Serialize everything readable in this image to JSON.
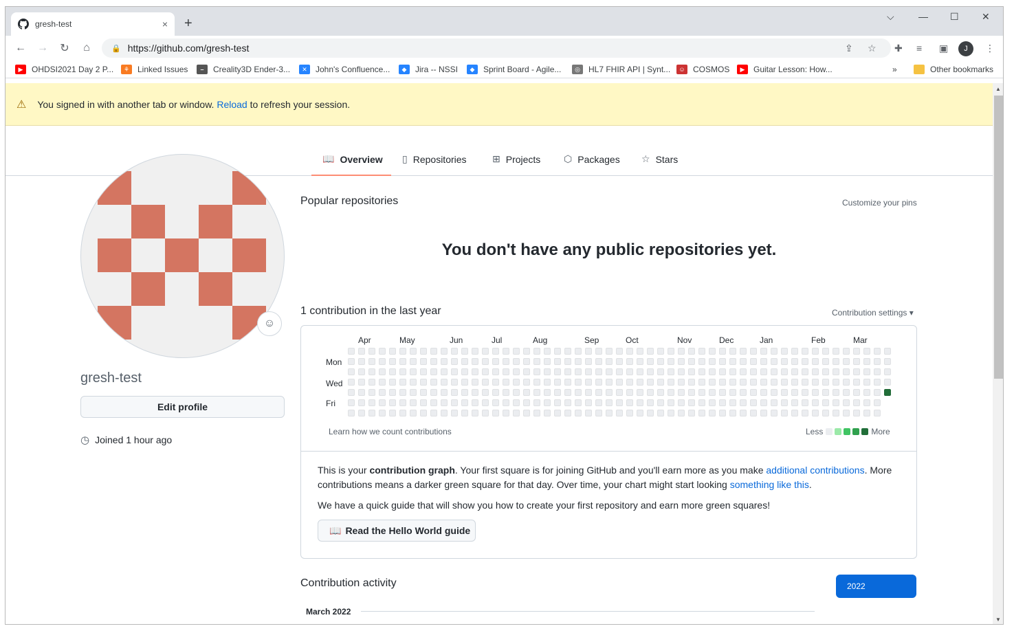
{
  "browser": {
    "tab_title": "gresh-test",
    "tab_close": "×",
    "new_tab": "+",
    "url": "https://github.com/gresh-test",
    "profile_initial": "J",
    "window_controls": [
      "⌵",
      "—",
      "☐",
      "✕"
    ]
  },
  "bookmarks": {
    "items": [
      {
        "label": "OHDSI2021 Day 2 P...",
        "icon": "youtube-icon",
        "color": "#ff0000"
      },
      {
        "label": "Linked Issues",
        "icon": "linked-issues-icon",
        "color": "#f97b22"
      },
      {
        "label": "Creality3D Ender-3...",
        "icon": "creality-icon",
        "color": "#555555"
      },
      {
        "label": "John's Confluence...",
        "icon": "confluence-icon",
        "color": "#2684ff"
      },
      {
        "label": "Jira -- NSSI",
        "icon": "jira-icon",
        "color": "#2684ff"
      },
      {
        "label": "Sprint Board - Agile...",
        "icon": "jira-icon",
        "color": "#2684ff"
      },
      {
        "label": "HL7 FHIR API | Synt...",
        "icon": "fhir-icon",
        "color": "#777777"
      },
      {
        "label": "COSMOS",
        "icon": "cosmos-icon",
        "color": "#cc3333"
      },
      {
        "label": "Guitar Lesson: How...",
        "icon": "youtube-icon",
        "color": "#ff0000"
      }
    ],
    "overflow": "»",
    "other": "Other bookmarks"
  },
  "flash": {
    "text_before": "You signed in with another tab or window.",
    "link": "Reload",
    "text_after": "to refresh your session."
  },
  "profile_tabs": [
    {
      "label": "Overview",
      "icon": "book-icon",
      "selected": true
    },
    {
      "label": "Repositories",
      "icon": "repo-icon",
      "selected": false
    },
    {
      "label": "Projects",
      "icon": "table-icon",
      "selected": false
    },
    {
      "label": "Packages",
      "icon": "package-icon",
      "selected": false
    },
    {
      "label": "Stars",
      "icon": "star-icon",
      "selected": false
    }
  ],
  "profile": {
    "username": "gresh-test",
    "edit_button": "Edit profile",
    "joined": "Joined 1 hour ago",
    "avatar_color": "#d47561"
  },
  "popular": {
    "heading": "Popular repositories",
    "customize": "Customize your pins",
    "empty": "You don't have any public repositories yet."
  },
  "contributions": {
    "heading": "1 contribution in the last year",
    "settings": "Contribution settings ▾",
    "months": [
      "Apr",
      "May",
      "Jun",
      "Jul",
      "Aug",
      "Sep",
      "Oct",
      "Nov",
      "Dec",
      "Jan",
      "Feb",
      "Mar"
    ],
    "day_labels": [
      "Mon",
      "Wed",
      "Fri"
    ],
    "learn": "Learn how we count contributions",
    "less": "Less",
    "more": "More",
    "legend_colors": [
      "#ebedf0",
      "#9be9a8",
      "#40c463",
      "#30a14e",
      "#216e39"
    ],
    "active_color": "#216e39",
    "callout_1": "This is your",
    "callout_bold": "contribution graph",
    "callout_2": ". Your first square is for joining GitHub and you'll earn more as you make",
    "callout_link1": "additional contributions",
    "callout_3": ". More contributions means a darker green square for that day. Over time, your chart might start looking",
    "callout_link2": "something like this",
    "callout_4": ".",
    "guide_text": "We have a quick guide that will show you how to create your first repository and earn more green squares!",
    "guide_button": "Read the Hello World guide"
  },
  "activity": {
    "heading": "Contribution activity",
    "year_button": "2022",
    "month_header": "March 2022"
  }
}
